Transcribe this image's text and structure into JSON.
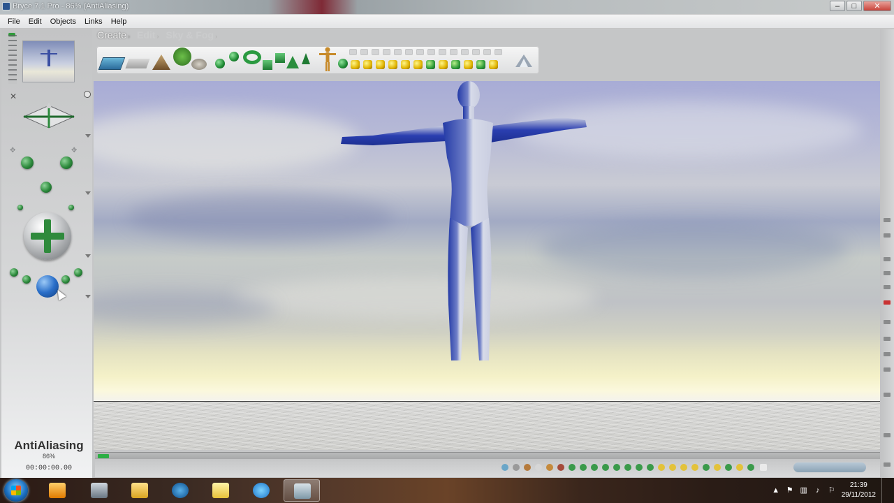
{
  "window": {
    "title": "Bryce 7.1 Pro - 86% (AntiAliasing)",
    "controls": [
      "–",
      "□",
      "✕"
    ]
  },
  "menu": [
    "File",
    "Edit",
    "Objects",
    "Links",
    "Help"
  ],
  "palette_tabs": {
    "create": "Create",
    "edit": "Edit",
    "sky_fog": "Sky & Fog"
  },
  "status": {
    "render_mode": "AntiAliasing",
    "progress_percent": "86%",
    "progress_fraction": 0.86,
    "time": "00:00:00.00"
  },
  "icons": {
    "create_tools": [
      "water-plane",
      "infinite-plane",
      "terrain",
      "tree",
      "rock",
      "torus-shape",
      "sphere-shape",
      "cube-shape",
      "pyramid-shape",
      "cone-shape",
      "figure",
      "boolean-shapes",
      "lights"
    ],
    "controls": [
      "camera-icon",
      "cross-control",
      "trackball",
      "bank-ball"
    ]
  },
  "taskbar": {
    "apps": [
      "start-button",
      "media-player",
      "cell-tool",
      "file-explorer",
      "hp-app",
      "folder",
      "internet-explorer",
      "bryce"
    ],
    "clock_time": "21:39",
    "clock_date": "29/11/2012"
  },
  "colors": {
    "accent_green": "#2c8a3c",
    "figure_blue": "#2b3fb0",
    "sky_top": "#a8acd6",
    "horizon": "#fbf8dd"
  }
}
